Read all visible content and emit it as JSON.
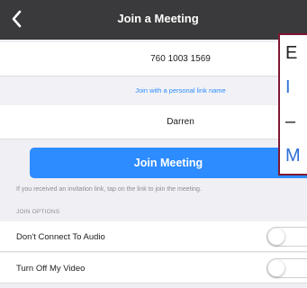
{
  "header": {
    "title": "Join a Meeting",
    "back_icon": "chevron-left-icon"
  },
  "meeting": {
    "meeting_id": "760 1003 1569",
    "personal_link_label": "Join with a personal link name",
    "display_name": "Darren"
  },
  "join_button_label": "Join Meeting",
  "hint_text": "If you received an invitation link, tap on the link to join the meeting.",
  "join_options": {
    "section_label": "JOIN OPTIONS",
    "items": [
      {
        "label": "Don't Connect To Audio",
        "enabled": false
      },
      {
        "label": "Turn Off My Video",
        "enabled": false
      }
    ]
  },
  "overlay_text": [
    "E",
    "I",
    "–",
    "M"
  ],
  "colors": {
    "navbar": "#3a3a3c",
    "accent": "#2d8cff",
    "overlay_border": "#7d1833",
    "overlay_link": "#2d6fd4"
  }
}
